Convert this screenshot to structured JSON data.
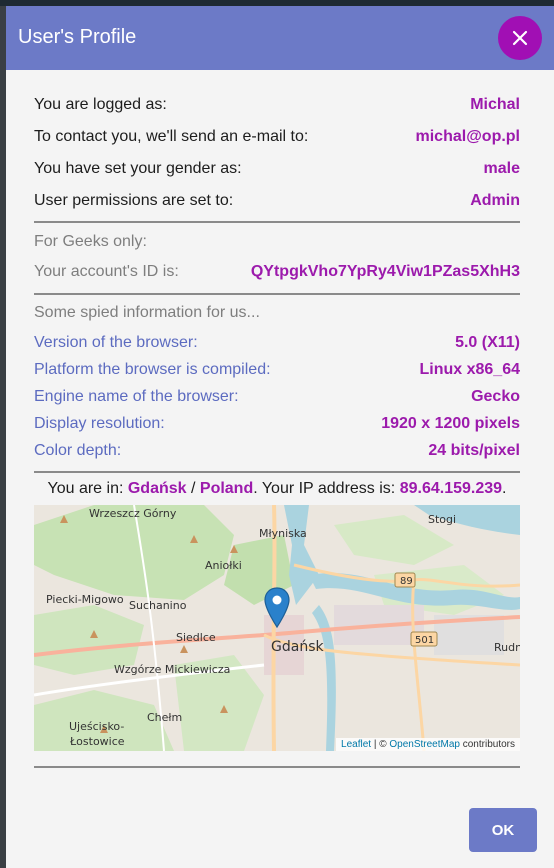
{
  "dialog": {
    "title": "User's Profile",
    "ok_label": "OK"
  },
  "user": {
    "logged_label": "You are logged as:",
    "logged_value": "Michal",
    "email_label": "To contact you, we'll send an e-mail to:",
    "email_value": "michal@op.pl",
    "gender_label": "You have set your gender as:",
    "gender_value": "male",
    "perm_label": "User permissions are set to:",
    "perm_value": "Admin"
  },
  "geeks": {
    "heading": "For Geeks only:",
    "id_label": "Your account's ID is:",
    "id_value": "QYtpgkVho7YpRy4Viw1PZas5XhH3"
  },
  "spied": {
    "heading": "Some spied information for us...",
    "items": [
      {
        "label": "Version of the browser:",
        "value": "5.0 (X11)"
      },
      {
        "label": "Platform the browser is compiled:",
        "value": "Linux x86_64"
      },
      {
        "label": "Engine name of the browser:",
        "value": "Gecko"
      },
      {
        "label": "Display resolution:",
        "value": "1920 x 1200 pixels"
      },
      {
        "label": "Color depth:",
        "value": "24 bits/pixel"
      }
    ]
  },
  "location": {
    "prefix": "You are in: ",
    "city": "Gdańsk",
    "sep": " / ",
    "country": "Poland",
    "ip_text": ". Your IP address is: ",
    "ip": "89.64.159.239",
    "suffix": "."
  },
  "map": {
    "labels": {
      "wrzeszcz": "Wrzeszcz Górny",
      "mlyniska": "Młyniska",
      "stogi": "Stogi",
      "aniolki": "Aniołki",
      "piecki": "Piecki-Migowo",
      "suchanino": "Suchanino",
      "siedlce": "Siedlce",
      "gdansk": "Gdańsk",
      "wzgorze": "Wzgórze Mickiewicza",
      "chelm": "Chełm",
      "ujescisko": "Ujeścisko-",
      "lostowice": "Łostowice",
      "rudn": "Rudn",
      "road89": "89",
      "road501": "501"
    },
    "attribution": {
      "leaflet": "Leaflet",
      "sep": " | © ",
      "osm": "OpenStreetMap",
      "suffix": " contributors"
    }
  },
  "colors": {
    "header": "#6c7ac7",
    "accent": "#9c1aac",
    "close": "#a10fb4",
    "spy_label": "#5c6bc0",
    "marker": "#2a81cb"
  }
}
